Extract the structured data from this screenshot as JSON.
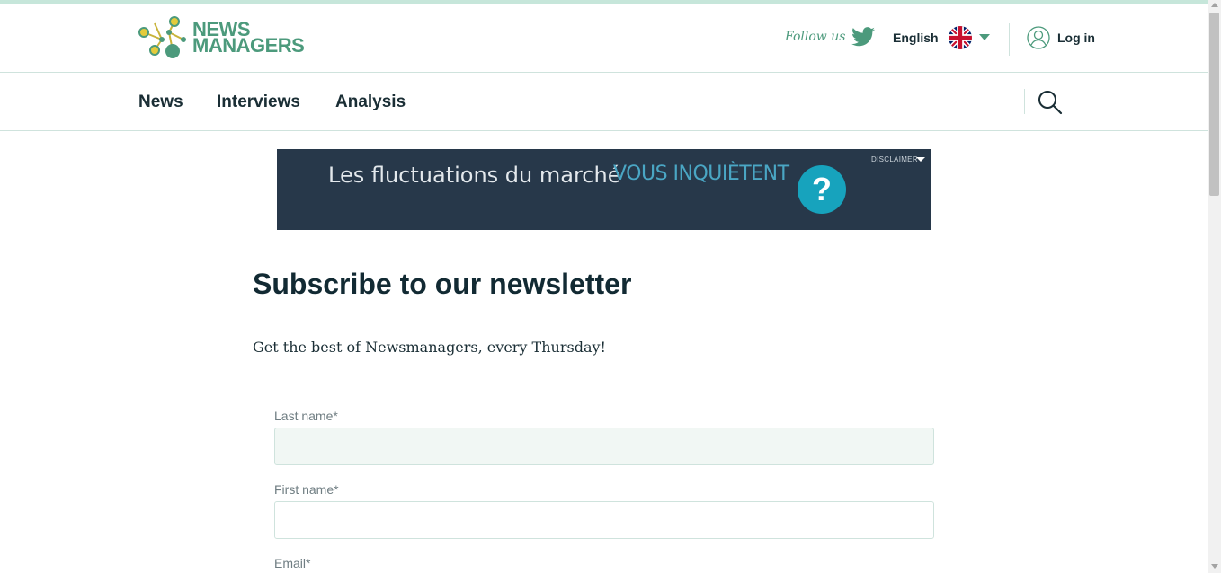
{
  "header": {
    "logo_line1": "NEWS",
    "logo_line2": "MANAGERS",
    "follow_us": "Follow us",
    "twitter_icon": "twitter-icon",
    "language": "English",
    "flag_icon": "uk-flag-icon",
    "login": "Log in",
    "user_icon": "user-icon"
  },
  "nav": {
    "items": [
      {
        "label": "News"
      },
      {
        "label": "Interviews"
      },
      {
        "label": "Analysis"
      }
    ],
    "search_icon": "search-icon"
  },
  "ad": {
    "text": "Les fluctuations du marché",
    "accent": "VOUS INQUIÈTENT",
    "question": "?",
    "disclaimer": "DISCLAIMER"
  },
  "main": {
    "title": "Subscribe to our newsletter",
    "subtitle": "Get the best of Newsmanagers, every Thursday!",
    "fields": [
      {
        "label": "Last name*",
        "value": ""
      },
      {
        "label": "First name*",
        "value": ""
      },
      {
        "label": "Email*",
        "value": ""
      }
    ]
  },
  "colors": {
    "brand_green": "#4c9a7c",
    "ad_bg": "#27384a",
    "ad_accent": "#4aa6c4",
    "question_bg": "#17a3bd"
  }
}
